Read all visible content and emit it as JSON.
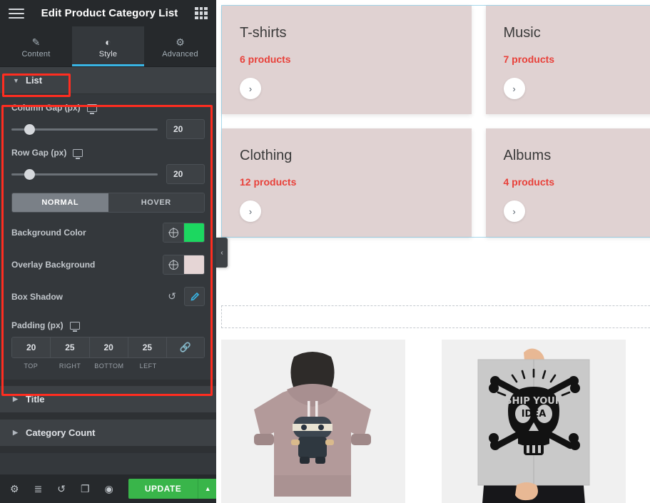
{
  "panel": {
    "header": {
      "title": "Edit Product Category List",
      "menu_icon": "hamburger-icon",
      "widgets_icon": "grid-icon"
    },
    "tabs": [
      {
        "label": "Content",
        "icon": "pencil-icon",
        "active": false
      },
      {
        "label": "Style",
        "icon": "contrast-icon",
        "active": true
      },
      {
        "label": "Advanced",
        "icon": "gear-icon",
        "active": false
      }
    ],
    "sections": [
      {
        "label": "List",
        "expanded": true,
        "caret": "▼"
      },
      {
        "label": "Title",
        "expanded": false,
        "caret": "▶"
      },
      {
        "label": "Category Count",
        "expanded": false,
        "caret": "▶"
      }
    ],
    "list_section": {
      "column_gap": {
        "label": "Column Gap (px)",
        "value": "20",
        "device_icon": "monitor-icon"
      },
      "row_gap": {
        "label": "Row Gap (px)",
        "value": "20",
        "device_icon": "monitor-icon"
      },
      "state_tabs": [
        {
          "label": "NORMAL",
          "active": true
        },
        {
          "label": "HOVER",
          "active": false
        }
      ],
      "background_color": {
        "label": "Background Color",
        "swatch": "#1cd760",
        "globe_icon": "globe-icon"
      },
      "overlay_background": {
        "label": "Overlay Background",
        "swatch": "#e5d5d5",
        "globe_icon": "globe-icon"
      },
      "box_shadow": {
        "label": "Box Shadow",
        "reset_icon": "reset-icon",
        "edit_icon": "pencil-icon"
      },
      "padding": {
        "label": "Padding (px)",
        "device_icon": "monitor-icon",
        "fields": [
          {
            "value": "20",
            "side": "TOP"
          },
          {
            "value": "25",
            "side": "RIGHT"
          },
          {
            "value": "20",
            "side": "BOTTOM"
          },
          {
            "value": "25",
            "side": "LEFT"
          }
        ],
        "link_icon": "link-icon"
      }
    },
    "footer": {
      "icons": [
        {
          "name": "settings-gear-icon",
          "glyph": "⚙"
        },
        {
          "name": "navigator-layers-icon",
          "glyph": "≣"
        },
        {
          "name": "history-icon",
          "glyph": "↺"
        },
        {
          "name": "responsive-mode-icon",
          "glyph": "❐"
        },
        {
          "name": "preview-eye-icon",
          "glyph": "◉"
        }
      ],
      "update_label": "UPDATE",
      "update_caret": "▲",
      "update_color": "#39b54a"
    }
  },
  "canvas": {
    "collapse_handle": "‹",
    "selection_border_color": "#a5d8ec",
    "categories": [
      {
        "title": "T-shirts",
        "count": "6 products",
        "arrow": "›"
      },
      {
        "title": "Music",
        "count": "7 products",
        "arrow": "›"
      },
      {
        "title": "Clothing",
        "count": "12 products",
        "arrow": "›"
      },
      {
        "title": "Albums",
        "count": "4 products",
        "arrow": "›"
      }
    ],
    "card_background": "#e0d2d2",
    "count_color": "#e8413a",
    "drop_zone": {
      "plus": "+"
    },
    "products": [
      {
        "name": "hoodie-ninja-product-image"
      },
      {
        "name": "poster-ship-your-idea-product-image",
        "poster_text_top": "SHIP YOUR",
        "poster_text_bottom": "IDEA"
      }
    ]
  },
  "annotations": [
    {
      "name": "list-section-highlight"
    },
    {
      "name": "list-controls-highlight"
    }
  ]
}
